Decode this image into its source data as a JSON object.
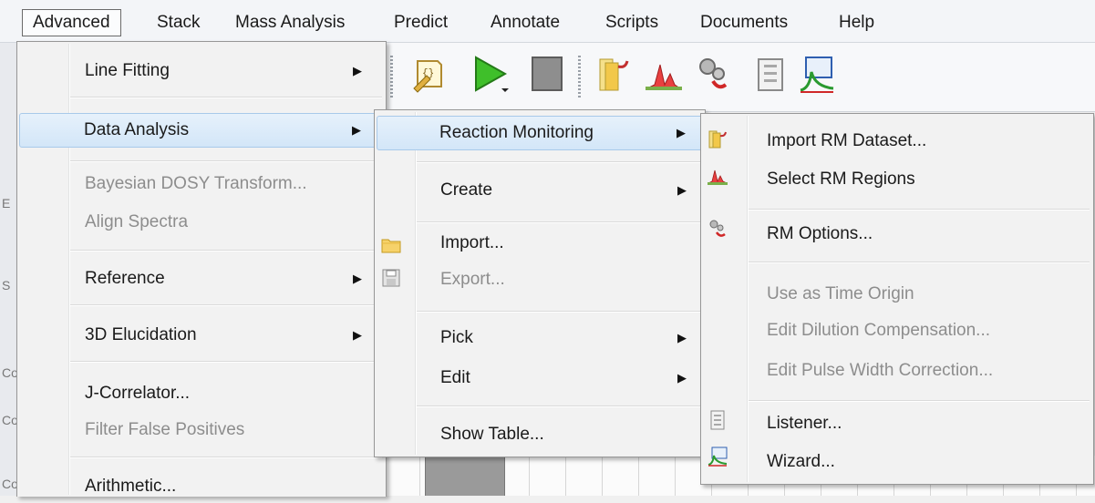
{
  "menubar": {
    "items": [
      "Advanced",
      "Stack",
      "Mass Analysis",
      "Predict",
      "Annotate",
      "Scripts",
      "Documents",
      "Help"
    ]
  },
  "advanced_menu": {
    "line_fitting": "Line Fitting",
    "data_analysis": "Data Analysis",
    "bayesian": "Bayesian DOSY Transform...",
    "align": "Align Spectra",
    "reference": "Reference",
    "elucidation": "3D Elucidation",
    "jcorrelator": "J-Correlator...",
    "filter": "Filter False Positives",
    "arithmetic": "Arithmetic..."
  },
  "data_analysis_menu": {
    "reaction_monitoring": "Reaction Monitoring",
    "create": "Create",
    "import": "Import...",
    "export": "Export...",
    "pick": "Pick",
    "edit": "Edit",
    "show_table": "Show Table..."
  },
  "rm_menu": {
    "import_rm": "Import RM Dataset...",
    "select_rm": "Select RM Regions",
    "rm_options": "RM Options...",
    "time_origin": "Use as Time Origin",
    "dilution": "Edit Dilution Compensation...",
    "pulse": "Edit Pulse Width Correction...",
    "listener": "Listener...",
    "wizard": "Wizard..."
  },
  "left_strip": [
    "E",
    "S",
    "Co",
    "Co",
    "Co"
  ],
  "icons": [
    "script-icon",
    "run-icon",
    "stop-icon",
    "import-rm-icon",
    "select-rm-icon",
    "rm-options-icon",
    "listener-icon",
    "wizard-icon"
  ]
}
